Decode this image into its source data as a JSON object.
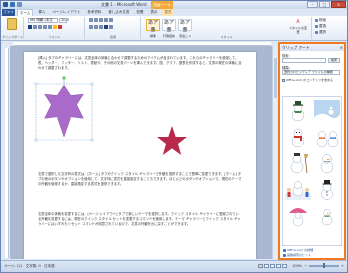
{
  "window": {
    "title": "文書 1 - Microsoft Word",
    "context_tab": "描画ツール",
    "controls": {
      "minimize": "–",
      "maximize": "□",
      "close": "×"
    }
  },
  "tabs": {
    "file": "ファイル",
    "items": [
      "ホーム",
      "挿入",
      "ページレイアウト",
      "参考資料",
      "差し込み文書",
      "校閲",
      "表示",
      "書式"
    ]
  },
  "ribbon": {
    "font_name": "MS 明朝 (本文",
    "font_size": "10.5",
    "groups": [
      "クリップボード",
      "フォント",
      "段落",
      "スタイル",
      "編集"
    ],
    "styles": [
      "標準",
      "行間詰め",
      "見出し 1",
      "スタイルの変更"
    ],
    "edit": [
      "検索",
      "置換",
      "選択"
    ]
  },
  "document": {
    "paragraph1": "[挿入] タブのギャラリーには、文書全体の体裁に合わせて調整するためのアイテムが含まれています。これらのギャラリーを使用して、表、ヘッダー、フッター、リスト、表紙や、その他の文書パーツを挿入できます。図、グラフ、図表を作成すると、文書の現在の体裁に合わせて調整されます。",
    "paragraph2": "文書で選択した文字列の書式は、[ホーム] タブのクイック スタイル ギャラリーで外観を選択することで簡単に変更できます。[ホーム] タブの他のボタンやオプションを使用して、文字列に書式を直接設定することもできます。ほとんどのボタンやオプションで、現在のテーマの外観を使用するか、直接指定する書式を選択できます。",
    "paragraph3": "文書全体の体裁を変更するには、[ページ レイアウト] タブで新しいテーマを選択します。クイック スタイル ギャラリーに登録されている外観を変更するには、現在のクイック スタイル セットを変更するコマンドを使用します。テーマ ギャラリーとクイック スタイル ギャラリーにはいずれもリセット コマンドが用意されているので、文書の外観を元に戻すことができます。",
    "star_purple_color": "#a96bc9",
    "star_red_color": "#b8294a"
  },
  "pane": {
    "title": "クリップ アート",
    "search_label": "検索:",
    "search_value": "",
    "go_button": "検索",
    "results_label": "種類:",
    "results_value": "選択されたメディア ファイルの種類",
    "include_office": "Office.com のコンテンツを含める",
    "more_link": "Office.com の詳細",
    "tips_link": "画像検索のヒント"
  },
  "status": {
    "page": "ページ: 1/1",
    "words": "文字数: 0",
    "language": "日本語",
    "zoom": "100%"
  }
}
